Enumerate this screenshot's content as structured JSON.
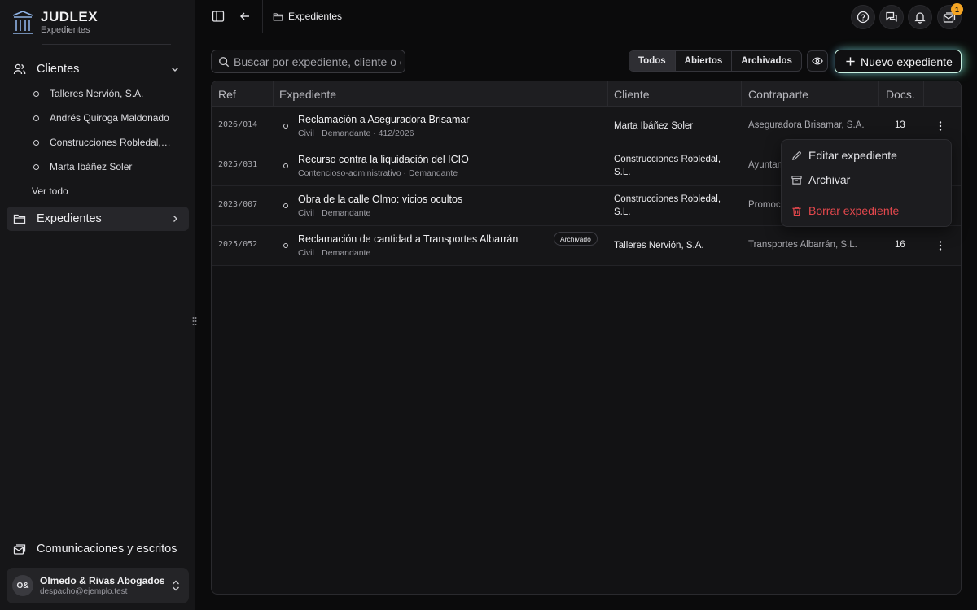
{
  "brand": {
    "title": "JUDLEX",
    "subtitle": "Expedientes"
  },
  "sidebar": {
    "clients_label": "Clientes",
    "clients": [
      "Talleres Nervión, S.A.",
      "Andrés Quiroga Maldonado",
      "Construcciones Robledal, S.L.",
      "Marta Ibáñez Soler"
    ],
    "see_all": "Ver todo",
    "expedientes_label": "Expedientes",
    "comms_label": "Comunicaciones y escritos"
  },
  "user": {
    "initials": "O&",
    "name": "Olmedo & Rivas Abogados",
    "email": "despacho@ejemplo.test"
  },
  "topbar": {
    "breadcrumb": "Expedientes",
    "notif_count": "1"
  },
  "toolbar": {
    "search_placeholder": "Buscar por expediente, cliente o contraparte",
    "filters": [
      "Todos",
      "Abiertos",
      "Archivados"
    ],
    "active_filter": "Todos",
    "new_label": "Nuevo expediente"
  },
  "table": {
    "columns": [
      "Ref",
      "Expediente",
      "Cliente",
      "Contraparte",
      "Docs."
    ],
    "rows": [
      {
        "ref": "2026/014",
        "title": "Reclamación a Aseguradora Brisamar",
        "meta": "Civil · Demandante · 412/2026",
        "client": "Marta Ibáñez Soler",
        "contra": "Aseguradora Brisamar, S.A.",
        "docs": "13"
      },
      {
        "ref": "2025/031",
        "title": "Recurso contra la liquidación del ICIO",
        "meta": "Contencioso-administrativo · Demandante",
        "client": "Construcciones Robledal, S.L.",
        "contra": "Ayuntam",
        "docs": ""
      },
      {
        "ref": "2023/007",
        "title": "Obra de la calle Olmo: vicios ocultos",
        "meta": "Civil · Demandante",
        "client": "Construcciones Robledal, S.L.",
        "contra": "Promoc",
        "docs": ""
      },
      {
        "ref": "2025/052",
        "title": "Reclamación de cantidad a Transportes Albarrán",
        "meta": "Civil · Demandante",
        "client": "Talleres Nervión, S.A.",
        "contra": "Transportes Albarrán, S.L.",
        "docs": "16",
        "badge": "Archivado"
      }
    ]
  },
  "menu": {
    "edit": "Editar expediente",
    "archive": "Archivar",
    "delete": "Borrar expediente"
  },
  "colors": {
    "accent_badge": "#f5a524",
    "danger": "#e5484d",
    "background": "#0b0b0c"
  }
}
